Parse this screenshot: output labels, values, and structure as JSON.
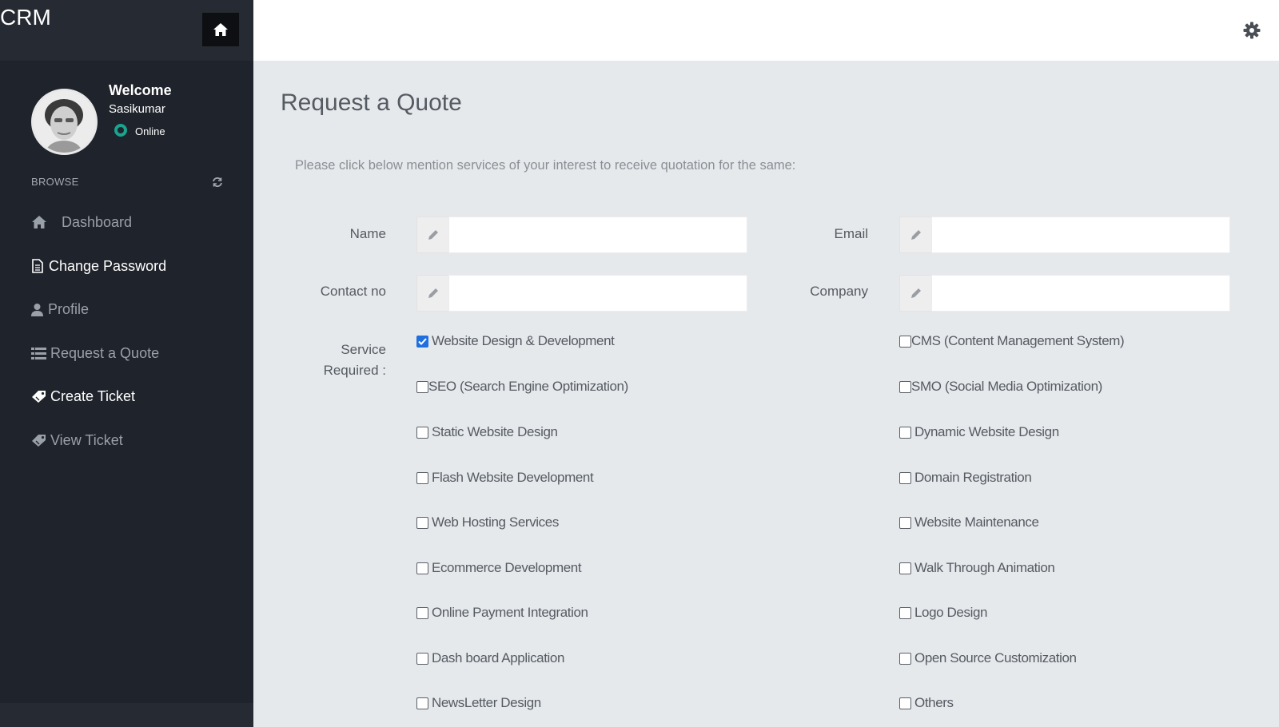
{
  "brand": "CRM",
  "profile": {
    "welcome": "Welcome",
    "username": "Sasikumar",
    "status": "Online",
    "status_color": "#1aa38e"
  },
  "sidebar": {
    "section_label": "BROWSE",
    "items": [
      {
        "label": "Dashboard",
        "icon": "home-icon",
        "active": false
      },
      {
        "label": "Change Password",
        "icon": "document-icon",
        "active": true
      },
      {
        "label": "Profile",
        "icon": "user-icon",
        "active": false
      },
      {
        "label": "Request a Quote",
        "icon": "list-icon",
        "active": false
      },
      {
        "label": "Create Ticket",
        "icon": "ticket-icon",
        "active": true
      },
      {
        "label": "View Ticket",
        "icon": "ticket-icon",
        "active": false
      }
    ]
  },
  "page": {
    "title": "Request a Quote",
    "subtitle": "Please click below mention services of your interest to receive quotation for the same:"
  },
  "form": {
    "name_label": "Name",
    "email_label": "Email",
    "contact_label": "Contact no",
    "company_label": "Company",
    "name_value": "",
    "email_value": "",
    "contact_value": "",
    "company_value": "",
    "service_label_line1": "Service",
    "service_label_line2": "Required :"
  },
  "services": {
    "left": [
      {
        "label": "Website Design & Development",
        "checked": true
      },
      {
        "label": "SEO (Search Engine Optimization)",
        "checked": false
      },
      {
        "label": "Static Website Design",
        "checked": false
      },
      {
        "label": "Flash Website Development",
        "checked": false
      },
      {
        "label": "Web Hosting Services",
        "checked": false
      },
      {
        "label": "Ecommerce Development",
        "checked": false
      },
      {
        "label": "Online Payment Integration",
        "checked": false
      },
      {
        "label": "Dash board Application",
        "checked": false
      },
      {
        "label": "NewsLetter Design",
        "checked": false
      }
    ],
    "right": [
      {
        "label": "CMS (Content Management System)",
        "checked": false
      },
      {
        "label": "SMO (Social Media Optimization)",
        "checked": false
      },
      {
        "label": "Dynamic Website Design",
        "checked": false
      },
      {
        "label": "Domain Registration",
        "checked": false
      },
      {
        "label": "Website Maintenance",
        "checked": false
      },
      {
        "label": "Walk Through Animation",
        "checked": false
      },
      {
        "label": "Logo Design",
        "checked": false
      },
      {
        "label": "Open Source Customization",
        "checked": false
      },
      {
        "label": "Others",
        "checked": false
      }
    ]
  },
  "colors": {
    "sidebar_bg": "#1f232b",
    "accent": "#1f6fe0"
  }
}
